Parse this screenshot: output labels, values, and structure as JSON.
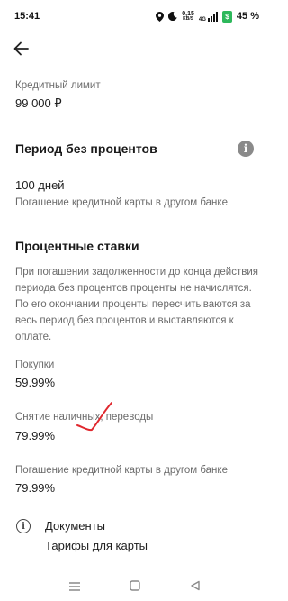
{
  "status_bar": {
    "time": "15:41",
    "net_speed_value": "0,15",
    "net_speed_unit": "KB/S",
    "network_type": "4G",
    "battery_percent": "45 %",
    "icons": [
      "location-icon",
      "moon-icon",
      "signal-icon",
      "battery-saver-icon"
    ]
  },
  "colors": {
    "battery_saver": "#2db85b",
    "annotation": "#e0282e",
    "secondary_text": "#6b6b6b"
  },
  "credit_limit": {
    "label": "Кредитный лимит",
    "value": "99 000 ₽"
  },
  "grace_period": {
    "title": "Период без процентов",
    "value": "100 дней",
    "description": "Погашение кредитной карты в другом банке"
  },
  "rates": {
    "title": "Процентные ставки",
    "description": "При погашении задолженности до конца действия периода без процентов проценты не начислятся. По его окончании проценты пересчитываются за весь период без процентов и выставляются к оплате.",
    "items": [
      {
        "label": "Покупки",
        "value": "59.99%"
      },
      {
        "label": "Снятие наличных, переводы",
        "value": "79.99%"
      },
      {
        "label": "Погашение кредитной карты в другом банке",
        "value": "79.99%"
      }
    ]
  },
  "documents": {
    "title": "Документы",
    "link": "Тарифы для карты"
  }
}
